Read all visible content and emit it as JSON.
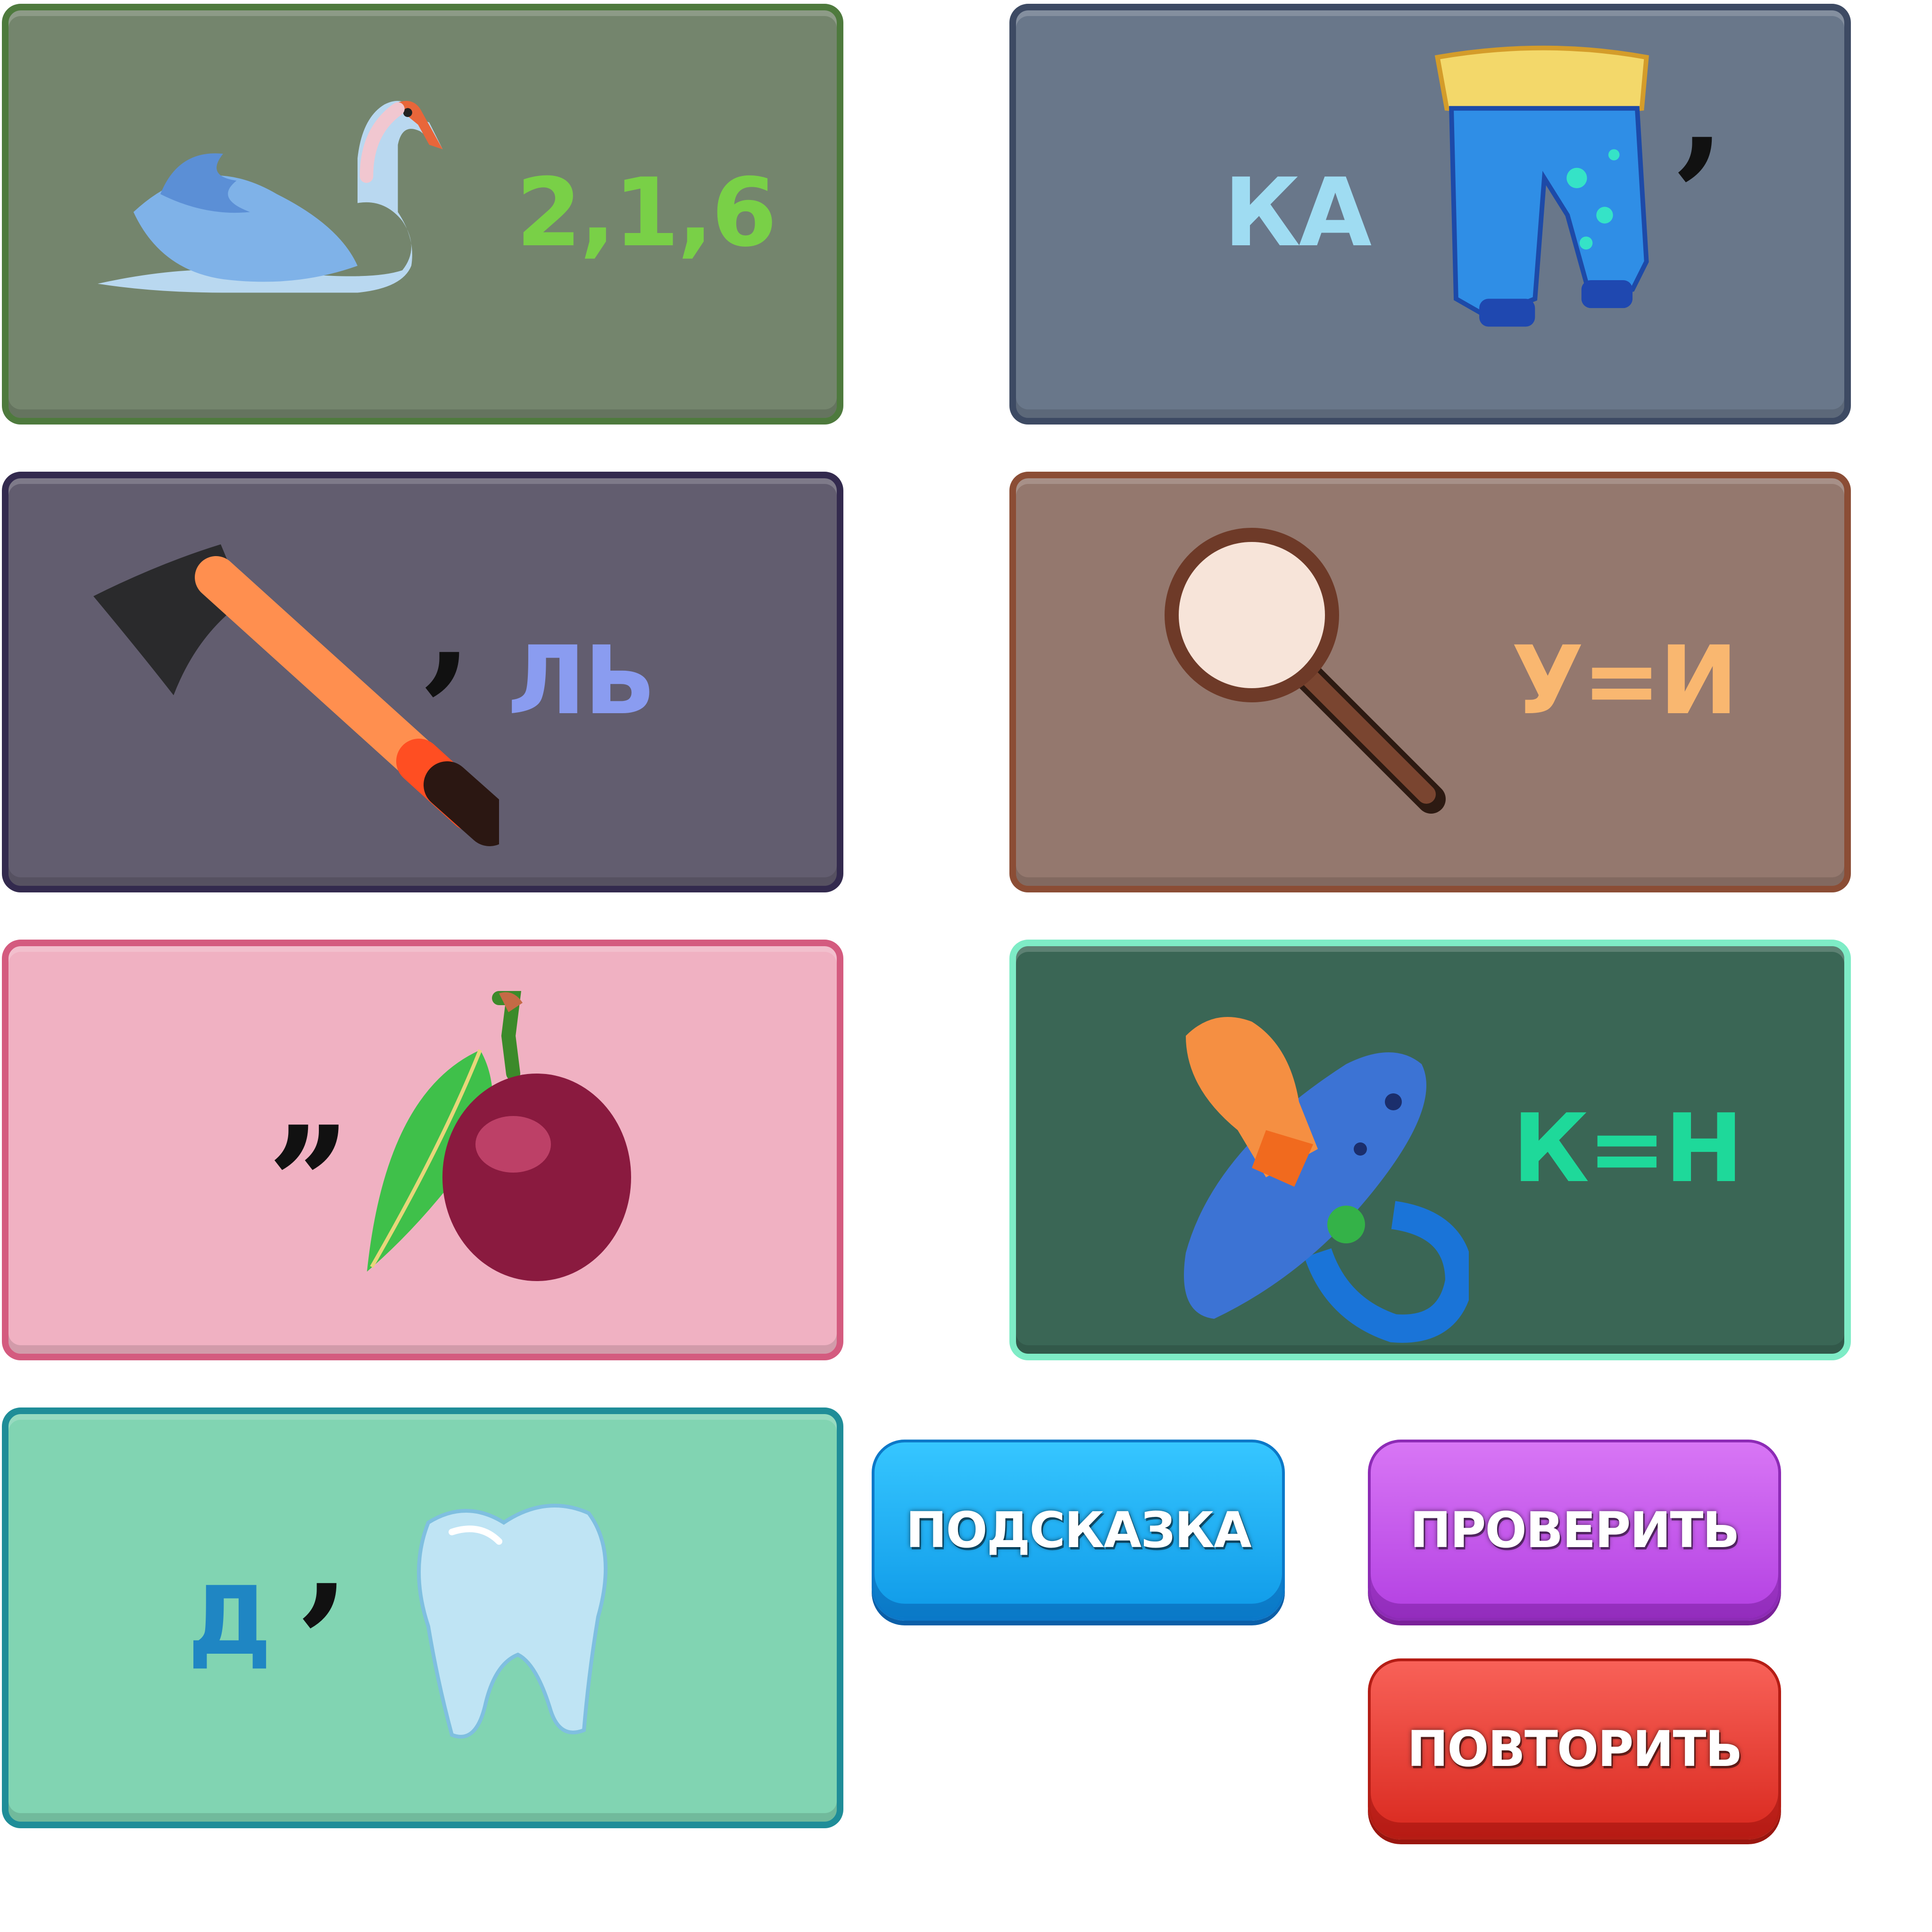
{
  "cards": [
    {
      "picture": "swan",
      "text": "2,1,6",
      "text_color": "#79d047",
      "bg": "#74856d",
      "border": "#4e7a3d"
    },
    {
      "picture": "trousers",
      "text_before": "КА",
      "mark": ",",
      "text_color": "#9fdcf2",
      "bg": "#69778a",
      "border": "#3d4a63"
    },
    {
      "picture": "axe",
      "mark": ",",
      "text": "ЛЬ",
      "text_color": "#8a9cf0",
      "bg": "#625d6f",
      "border": "#332a4e"
    },
    {
      "picture": "magnifying-glass",
      "text": "У=И",
      "text_color": "#f9b770",
      "bg": "#94786e",
      "border": "#8b4d35"
    },
    {
      "picture": "plum",
      "mark": ",,",
      "bg": "#f0b1c2",
      "border": "#d45b7f"
    },
    {
      "picture": "pacifier",
      "text": "К=Н",
      "text_color": "#1ed99a",
      "bg": "#3a6655",
      "border": "#7eecc6"
    },
    {
      "picture": "tooth",
      "text_before": "Д",
      "mark": ",",
      "text_color": "#1f86c3",
      "bg": "#81d4b2",
      "border": "#1f8d98"
    }
  ],
  "buttons": {
    "hint": "ПОДСКАЗКА",
    "check": "ПРОВЕРИТЬ",
    "repeat": "ПОВТОРИТЬ"
  },
  "colors": {
    "hint_button": "#12aaf0",
    "check_button": "#c04ee8",
    "repeat_button": "#e8332b"
  }
}
